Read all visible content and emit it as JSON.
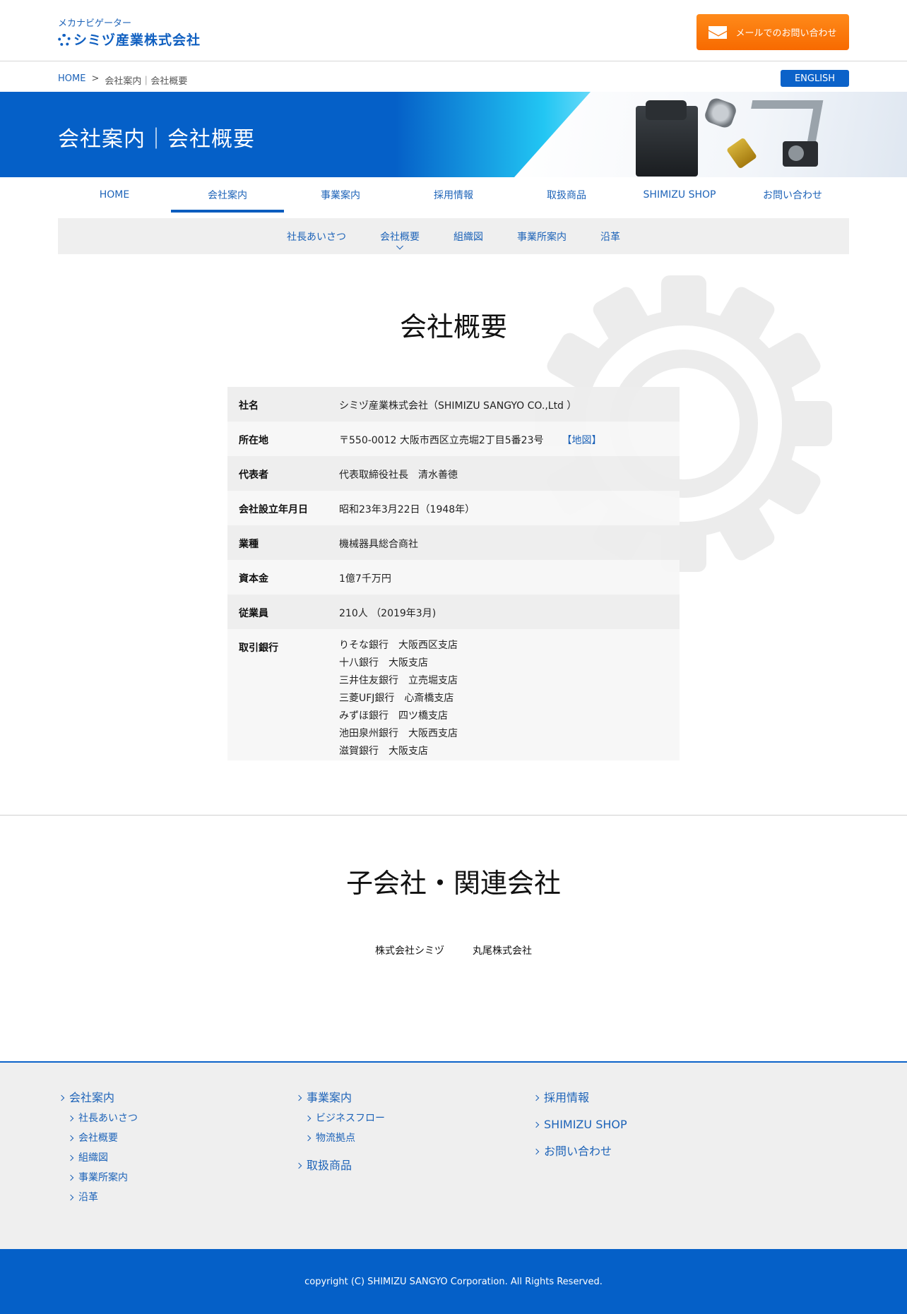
{
  "header": {
    "logo_sub": "メカナビゲーター",
    "logo_main": "シミヅ産業株式会社",
    "contact_button": "メールでのお問い合わせ",
    "contact_icon": "mail-icon"
  },
  "breadcrumb": {
    "home": "HOME",
    "separator": ">",
    "current": "会社案内｜会社概要"
  },
  "english_button": "ENGLISH",
  "hero": {
    "title": "会社案内｜会社概要"
  },
  "nav": {
    "items": [
      {
        "label": "HOME"
      },
      {
        "label": "会社案内"
      },
      {
        "label": "事業案内"
      },
      {
        "label": "採用情報"
      },
      {
        "label": "取扱商品"
      },
      {
        "label": "SHIMIZU SHOP"
      },
      {
        "label": "お問い合わせ"
      }
    ],
    "active": "会社案内"
  },
  "subnav": {
    "items": [
      {
        "label": "社長あいさつ"
      },
      {
        "label": "会社概要"
      },
      {
        "label": "組織図"
      },
      {
        "label": "事業所案内"
      },
      {
        "label": "沿革"
      }
    ],
    "active": "会社概要"
  },
  "overview": {
    "title": "会社概要",
    "rows": [
      {
        "label": "社名",
        "value": "シミヅ産業株式会社（SHIMIZU SANGYO CO.,Ltd ）"
      },
      {
        "label": "所在地",
        "value": "〒550-0012 大阪市西区立売堀2丁目5番23号",
        "link": "【地図】"
      },
      {
        "label": "代表者",
        "value": "代表取締役社長　清水善徳"
      },
      {
        "label": "会社設立年月日",
        "value": "昭和23年3月22日（1948年）"
      },
      {
        "label": "業種",
        "value": "機械器具総合商社"
      },
      {
        "label": "資本金",
        "value": "1億7千万円"
      },
      {
        "label": "従業員",
        "value": "210人 （2019年3月)"
      },
      {
        "label": "取引銀行",
        "banks": [
          "りそな銀行　大阪西区支店",
          "十八銀行　大阪支店",
          "三井住友銀行　立売堀支店",
          "三菱UFJ銀行　心斎橋支店",
          "みずほ銀行　四ツ橋支店",
          "池田泉州銀行　大阪西支店",
          "滋賀銀行　大阪支店"
        ]
      }
    ]
  },
  "subsidiaries": {
    "title": "子会社・関連会社",
    "items": [
      "株式会社シミヅ",
      "丸尾株式会社"
    ]
  },
  "footer": {
    "col1": {
      "head": "会社案内",
      "items": [
        "社長あいさつ",
        "会社概要",
        "組織図",
        "事業所案内",
        "沿革"
      ]
    },
    "col2": {
      "head": "事業案内",
      "items": [
        "ビジネスフロー",
        "物流拠点"
      ],
      "head2": "取扱商品"
    },
    "col3": {
      "items": [
        "採用情報",
        "SHIMIZU SHOP",
        "お問い合わせ"
      ]
    },
    "copyright": "copyright (C) SHIMIZU SANGYO Corporation. All Rights Reserved."
  },
  "colors": {
    "brand_blue": "#0560c8",
    "link_blue": "#1d63b8",
    "accent_orange": "#f77a10"
  }
}
